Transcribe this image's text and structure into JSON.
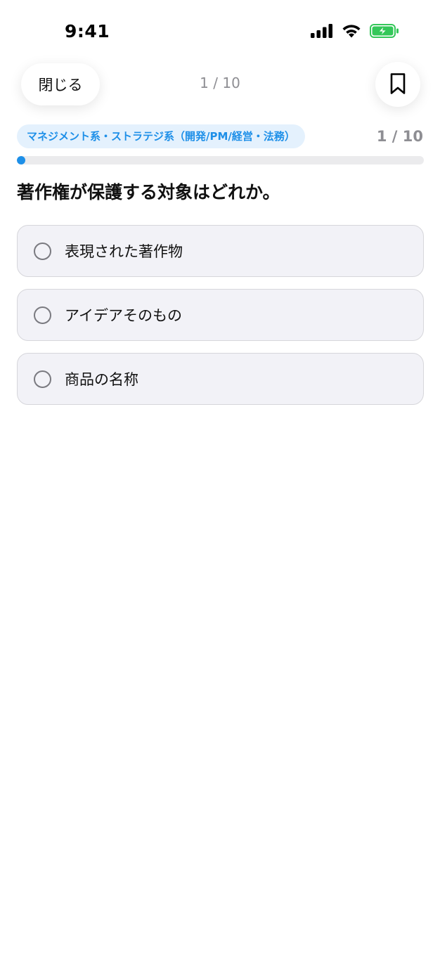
{
  "status_bar": {
    "time": "9:41",
    "icons": [
      "cellular-signal-icon",
      "wifi-icon",
      "battery-charging-icon"
    ],
    "battery_color": "#34c759"
  },
  "nav": {
    "close_label": "閉じる",
    "counter": "1 / 10",
    "bookmark_icon": "bookmark-icon"
  },
  "quiz": {
    "category": "マネジメント系・ストラテジ系（開発/PM/経営・法務）",
    "progress_label": "1 / 10",
    "progress_fraction": 0.1,
    "question": "著作権が保護する対象はどれか。",
    "options": [
      {
        "label": "表現された著作物"
      },
      {
        "label": "アイデアそのもの"
      },
      {
        "label": "商品の名称"
      }
    ]
  },
  "colors": {
    "accent": "#1d8fe8",
    "badge_bg": "#e4f1fd",
    "option_bg": "#f2f2f7",
    "muted_text": "#8e8e93"
  }
}
